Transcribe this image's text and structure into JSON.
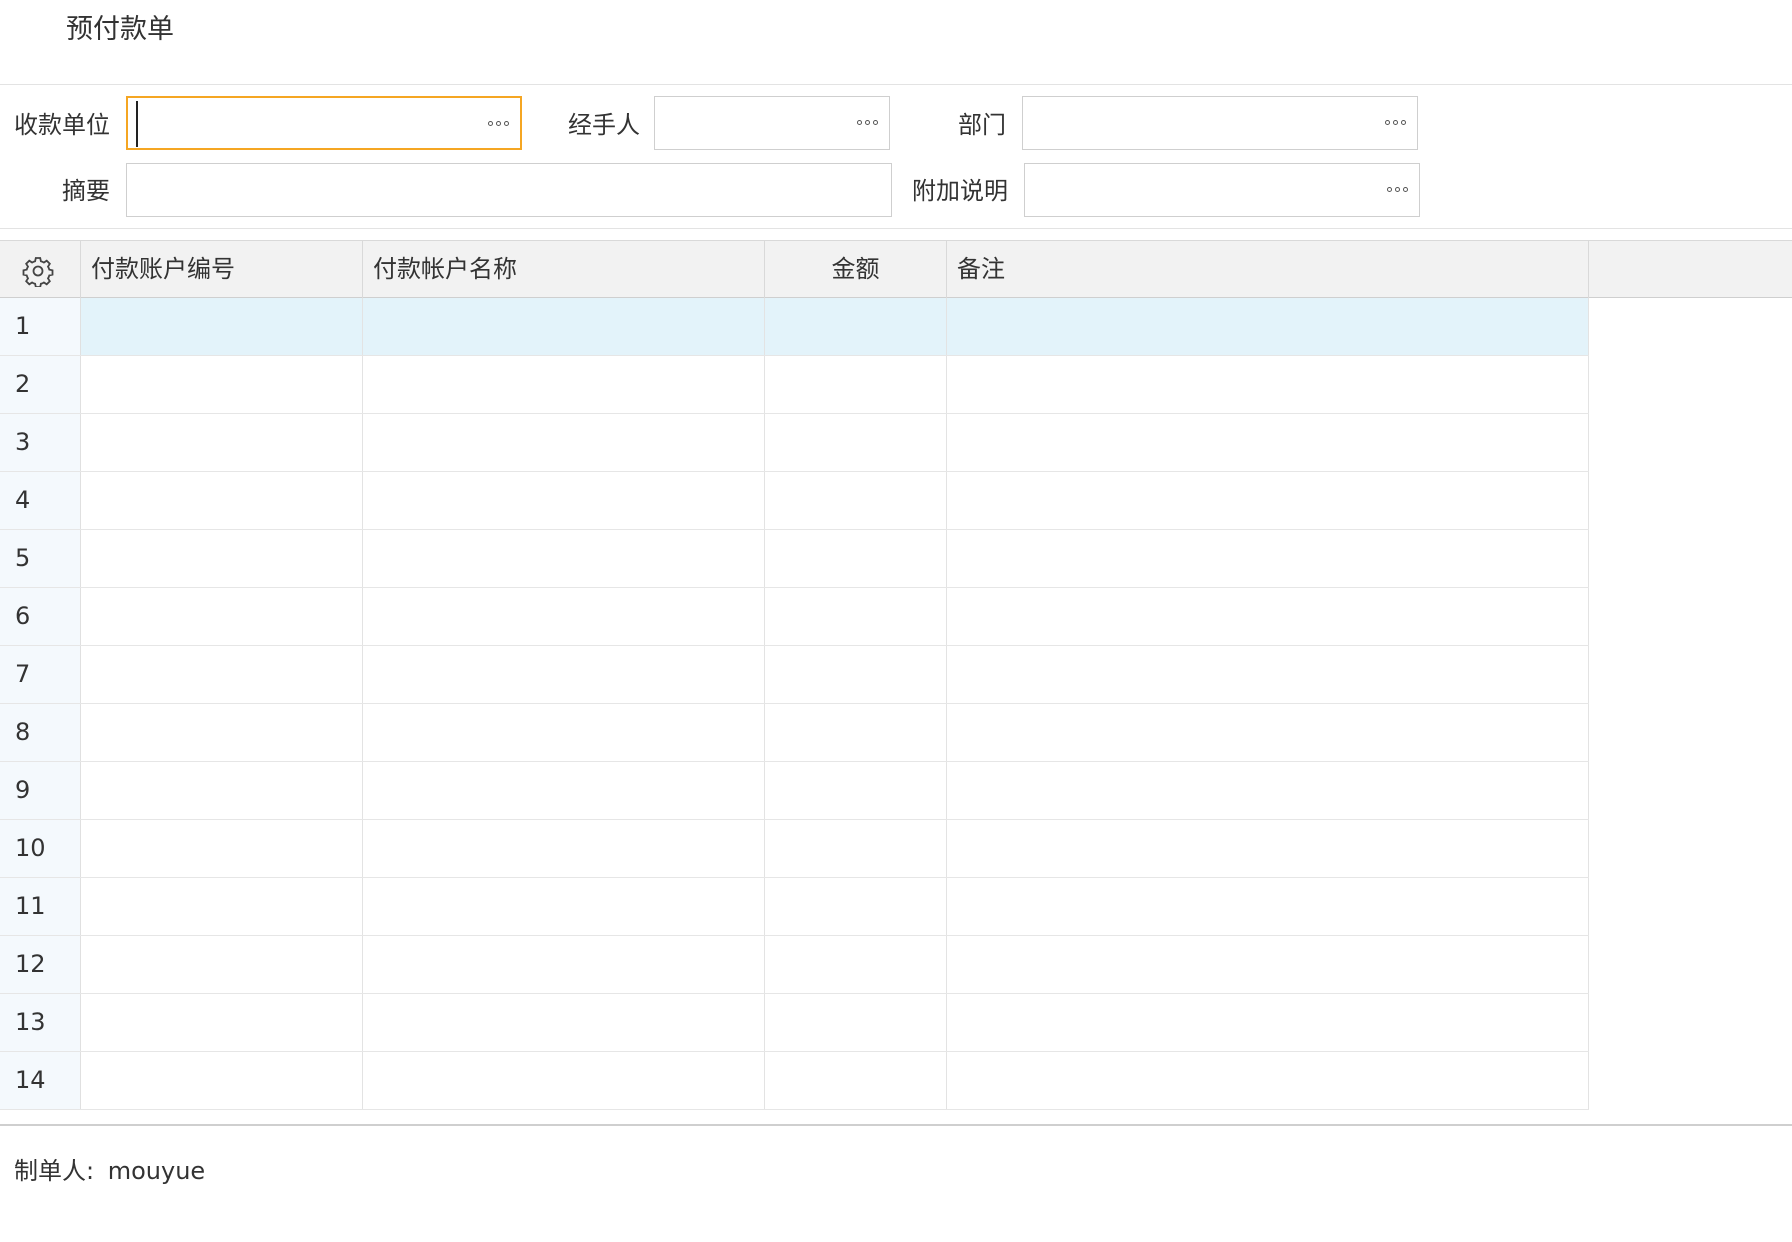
{
  "page": {
    "title": "预付款单"
  },
  "form": {
    "payee_label": "收款单位",
    "payee_value": "",
    "handler_label": "经手人",
    "handler_value": "",
    "dept_label": "部门",
    "dept_value": "",
    "summary_label": "摘要",
    "summary_value": "",
    "extra_label": "附加说明",
    "extra_value": ""
  },
  "grid": {
    "settings_icon": "gear-icon",
    "columns": [
      "付款账户编号",
      "付款帐户名称",
      "金额",
      "备注"
    ],
    "rows": [
      {
        "n": "1",
        "cells": [
          "",
          "",
          "",
          ""
        ]
      },
      {
        "n": "2",
        "cells": [
          "",
          "",
          "",
          ""
        ]
      },
      {
        "n": "3",
        "cells": [
          "",
          "",
          "",
          ""
        ]
      },
      {
        "n": "4",
        "cells": [
          "",
          "",
          "",
          ""
        ]
      },
      {
        "n": "5",
        "cells": [
          "",
          "",
          "",
          ""
        ]
      },
      {
        "n": "6",
        "cells": [
          "",
          "",
          "",
          ""
        ]
      },
      {
        "n": "7",
        "cells": [
          "",
          "",
          "",
          ""
        ]
      },
      {
        "n": "8",
        "cells": [
          "",
          "",
          "",
          ""
        ]
      },
      {
        "n": "9",
        "cells": [
          "",
          "",
          "",
          ""
        ]
      },
      {
        "n": "10",
        "cells": [
          "",
          "",
          "",
          ""
        ]
      },
      {
        "n": "11",
        "cells": [
          "",
          "",
          "",
          ""
        ]
      },
      {
        "n": "12",
        "cells": [
          "",
          "",
          "",
          ""
        ]
      },
      {
        "n": "13",
        "cells": [
          "",
          "",
          "",
          ""
        ]
      },
      {
        "n": "14",
        "cells": [
          "",
          "",
          "",
          ""
        ]
      }
    ],
    "selected_row": "1"
  },
  "footer": {
    "creator_label": "制单人:",
    "creator_value": "mouyue"
  },
  "colors": {
    "focus_border": "#f5a623",
    "selected_row": "#e3f3fa",
    "header_bg": "#f2f2f2"
  }
}
